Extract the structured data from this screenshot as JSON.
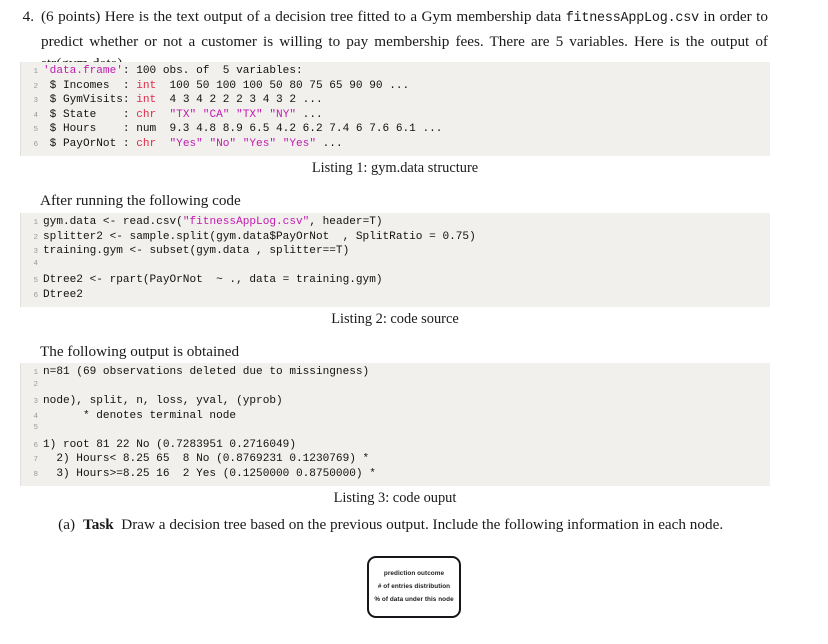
{
  "problem": {
    "number": "4.",
    "text_part1": "(6 points) Here is the text output of a decision tree fitted to a Gym membership data ",
    "mono1": "fitnessAppLog.csv",
    "text_part2": " in order to predict whether or not a customer is willing to pay membership fees. There are 5 variables. Here is the output of str(gym.data)."
  },
  "listing1": {
    "caption": "Listing 1: gym.data structure",
    "lines": [
      {
        "n": "1",
        "segs": [
          {
            "t": "",
            "c": "plain"
          },
          {
            "t": "'data.frame'",
            "c": "str"
          },
          {
            "t": ": 100 obs. of  5 variables:",
            "c": "plain"
          }
        ]
      },
      {
        "n": "2",
        "segs": [
          {
            "t": " $ Incomes  : ",
            "c": "plain"
          },
          {
            "t": "int",
            "c": "type"
          },
          {
            "t": "  100 50 100 100 50 80 75 65 90 90 ...",
            "c": "plain"
          }
        ]
      },
      {
        "n": "3",
        "segs": [
          {
            "t": " $ GymVisits: ",
            "c": "plain"
          },
          {
            "t": "int",
            "c": "type"
          },
          {
            "t": "  4 3 4 2 2 2 3 4 3 2 ...",
            "c": "plain"
          }
        ]
      },
      {
        "n": "4",
        "segs": [
          {
            "t": " $ State    : ",
            "c": "plain"
          },
          {
            "t": "chr",
            "c": "type"
          },
          {
            "t": "  ",
            "c": "plain"
          },
          {
            "t": "\"TX\" \"CA\" \"TX\" \"NY\"",
            "c": "str"
          },
          {
            "t": " ...",
            "c": "plain"
          }
        ]
      },
      {
        "n": "5",
        "segs": [
          {
            "t": " $ Hours    : num  9.3 4.8 8.9 6.5 4.2 6.2 7.4 6 7.6 6.1 ...",
            "c": "plain"
          }
        ]
      },
      {
        "n": "6",
        "segs": [
          {
            "t": " $ PayOrNot : ",
            "c": "plain"
          },
          {
            "t": "chr",
            "c": "type"
          },
          {
            "t": "  ",
            "c": "plain"
          },
          {
            "t": "\"Yes\" \"No\" \"Yes\" \"Yes\"",
            "c": "str"
          },
          {
            "t": " ...",
            "c": "plain"
          }
        ]
      }
    ]
  },
  "lead1": "After running the following code",
  "listing2": {
    "caption": "Listing 2: code source",
    "lines": [
      {
        "n": "1",
        "segs": [
          {
            "t": "gym.data <- read.csv(",
            "c": "plain"
          },
          {
            "t": "\"fitnessAppLog.csv\"",
            "c": "str"
          },
          {
            "t": ", header=T)",
            "c": "plain"
          }
        ]
      },
      {
        "n": "2",
        "segs": [
          {
            "t": "splitter2 <- sample.split(gym.data$PayOrNot  , SplitRatio = 0.75)",
            "c": "plain"
          }
        ]
      },
      {
        "n": "3",
        "segs": [
          {
            "t": "training.gym <- subset(gym.data , splitter==T)",
            "c": "plain"
          }
        ]
      },
      {
        "n": "4",
        "segs": [
          {
            "t": "",
            "c": "plain"
          }
        ]
      },
      {
        "n": "5",
        "segs": [
          {
            "t": "Dtree2 <- rpart(PayOrNot  ~ ., data = training.gym)",
            "c": "plain"
          }
        ]
      },
      {
        "n": "6",
        "segs": [
          {
            "t": "Dtree2",
            "c": "plain"
          }
        ]
      }
    ]
  },
  "lead2": "The following output is obtained",
  "listing3": {
    "caption": "Listing 3: code ouput",
    "lines": [
      {
        "n": "1",
        "segs": [
          {
            "t": "n=81 (69 observations deleted due to missingness)",
            "c": "plain"
          }
        ]
      },
      {
        "n": "2",
        "segs": [
          {
            "t": "",
            "c": "plain"
          }
        ]
      },
      {
        "n": "3",
        "segs": [
          {
            "t": "node), split, n, loss, yval, (yprob)",
            "c": "plain"
          }
        ]
      },
      {
        "n": "4",
        "segs": [
          {
            "t": "      * denotes terminal node",
            "c": "plain"
          }
        ]
      },
      {
        "n": "5",
        "segs": [
          {
            "t": "",
            "c": "plain"
          }
        ]
      },
      {
        "n": "6",
        "segs": [
          {
            "t": "1) root 81 22 No (0.7283951 0.2716049)",
            "c": "plain"
          }
        ]
      },
      {
        "n": "7",
        "segs": [
          {
            "t": "  2) Hours< 8.25 65  8 No (0.8769231 0.1230769) *",
            "c": "plain"
          }
        ]
      },
      {
        "n": "8",
        "segs": [
          {
            "t": "  3) Hours>=8.25 16  2 Yes (0.1250000 0.8750000) *",
            "c": "plain"
          }
        ]
      }
    ]
  },
  "task": {
    "label": "(a)",
    "strong": "Task",
    "text": "Draw a decision tree based on the previous output. Include the following information in each node."
  },
  "nodebox": {
    "line1": "prediction outcome",
    "line2": "# of entries distribution",
    "line3": "% of data under this node"
  },
  "colors": {
    "code_bg": "#f2f0ec",
    "string": "#c11bb1",
    "type": "#e0294a",
    "line_number": "#9a9a94",
    "text": "#1a1a1a"
  }
}
